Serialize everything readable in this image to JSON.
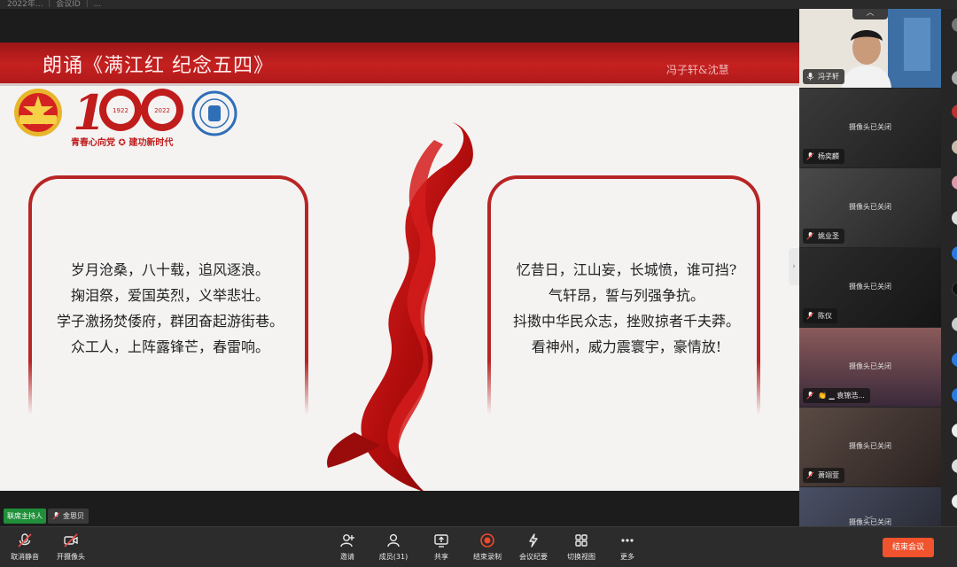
{
  "topbar": {
    "text": "2022年... ｜ 会议ID ｜ ..."
  },
  "slide": {
    "title": "朗诵《满江红 纪念五四》",
    "authors": "冯子轩&沈慧",
    "slogan": "青春心向党 ✪ 建功新时代",
    "years": [
      "1922",
      "2022"
    ],
    "hundred": "100",
    "poem_left": [
      "岁月沧桑，八十载，追风逐浪。",
      "掬泪祭，爱国英烈，义举悲壮。",
      "学子激扬焚倭府，群团奋起游街巷。",
      "众工人，上阵露锋芒，春雷响。"
    ],
    "poem_right": [
      "忆昔日，江山妄，长城愤，谁可挡?",
      "气轩昂，誓与列强争抗。",
      "抖擞中华民众志，挫败掠者千夫莽。",
      "看神州，威力震寰宇，豪情放!"
    ],
    "colors": {
      "header": "#c62020",
      "frame": "#b82525",
      "ribbon": "#c81414"
    }
  },
  "video_tiles": [
    {
      "name": "冯子轩",
      "camera_on": true,
      "cam_off_text": ""
    },
    {
      "name": "杨奕麟",
      "camera_on": false,
      "cam_off_text": "摄像头已关闭"
    },
    {
      "name": "姚业圣",
      "camera_on": false,
      "cam_off_text": "摄像头已关闭"
    },
    {
      "name": "陈仪",
      "camera_on": false,
      "cam_off_text": "摄像头已关闭"
    },
    {
      "name": "👏 ▁ 袁锦浩...",
      "camera_on": false,
      "cam_off_text": "摄像头已关闭"
    },
    {
      "name": "萧翊萱",
      "camera_on": false,
      "cam_off_text": "摄像头已关闭"
    },
    {
      "name": "",
      "camera_on": false,
      "cam_off_text": "摄像头已关闭"
    }
  ],
  "host": {
    "badge": "联席主持人",
    "name": "金思贝"
  },
  "toolbar": {
    "mute": "取消静音",
    "camera": "开摄像头",
    "invite": "邀请",
    "members": "成员(31)",
    "share": "共享",
    "record": "结束录制",
    "minutes": "会议纪要",
    "view": "切换视图",
    "more": "更多",
    "end": "结束会议"
  },
  "icons": {
    "mic": "mic-muted-icon",
    "camera": "camera-off-icon",
    "invite": "add-person-icon",
    "members": "people-icon",
    "share": "screen-share-icon",
    "record": "record-icon",
    "minutes": "ai-spark-icon",
    "view": "grid-view-icon",
    "more": "more-dots-icon"
  }
}
